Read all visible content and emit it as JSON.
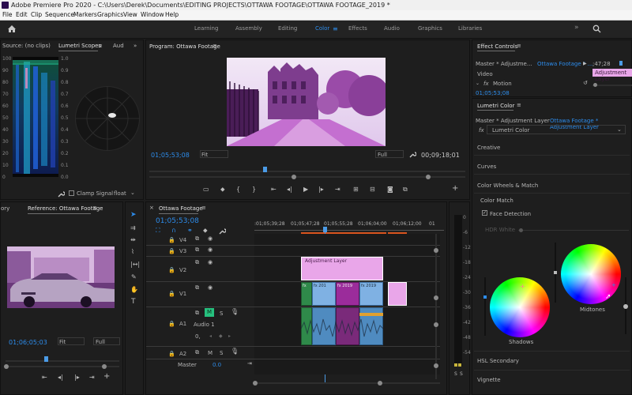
{
  "title_bar": {
    "text": "Adobe Premiere Pro 2020 - C:\\Users\\Derek\\Documents\\EDITING PROJECTS\\OTTAWA FOOTAGE\\OTTAWA FOOTAGE_2019 *"
  },
  "menu": [
    "File",
    "Edit",
    "Clip",
    "Sequence",
    "Markers",
    "Graphics",
    "View",
    "Window",
    "Help"
  ],
  "workspace_tabs": [
    "Learning",
    "Assembly",
    "Editing",
    "Color",
    "Effects",
    "Audio",
    "Graphics",
    "Libraries"
  ],
  "active_workspace": "Color",
  "colors": {
    "accent": "#2d8ceb",
    "adjustment_layer": "#e9a6e9",
    "video_clip": "#7fb1e3",
    "audio_clip": "#2f8a4a",
    "purple_clip": "#9b2c9b",
    "playhead": "#4b9be6"
  },
  "scopes_panel": {
    "tabs": [
      "Source: (no clips)",
      "Lumetri Scopes",
      "Aud"
    ],
    "scale_left": [
      "100",
      "90",
      "80",
      "70",
      "60",
      "50",
      "40",
      "30",
      "20",
      "10",
      "0"
    ],
    "scale_right": [
      "1.0",
      "0.9",
      "0.8",
      "0.7",
      "0.6",
      "0.5",
      "0.4",
      "0.3",
      "0.2",
      "0.1",
      "0.0"
    ],
    "clamp_signal": "Clamp Signal",
    "float": "float"
  },
  "program_monitor": {
    "title": "Program: Ottawa Footage",
    "current_time": "01;05;53;08",
    "fit": "Fit",
    "quality": "Full",
    "duration": "00;09;18;01"
  },
  "effect_controls": {
    "title": "Effect Controls",
    "master": "Master * Adjustme...",
    "sequence": "Ottawa Footage * ...",
    "ruler_time": ";47;28",
    "clip_label": "Adjustment Layer",
    "video_label": "Video",
    "motion": "Motion",
    "time": "01;05;53;08"
  },
  "reference_monitor": {
    "tab_left": "ory",
    "title": "Reference: Ottawa Footage",
    "time": "01;06;05;03",
    "fit": "Fit",
    "quality": "Full"
  },
  "timeline": {
    "title": "Ottawa Footage",
    "time": "01;05;53;08",
    "ruler": ":01;05;39;28",
    "ruler2": "01;05;47;28",
    "ruler3": "01;05;55;28",
    "ruler4": "01;06;04;00",
    "ruler5": "01;06;12;00",
    "ruler6": "01",
    "tracks_video": [
      "V4",
      "V3",
      "V2",
      "V1"
    ],
    "tracks_audio": [
      "A1",
      "A2"
    ],
    "audio1_name": "Audio 1",
    "master_label": "Master",
    "master_value": "0.0",
    "adjustment_clip": "Adjustment Layer",
    "v1_labels": [
      "fx",
      "fx 201",
      "fx 2019",
      "fx 2019"
    ],
    "mute": "M",
    "solo": "S",
    "audio_zero": "0,",
    "meter_scale": [
      "0",
      "-6",
      "-12",
      "-18",
      "-24",
      "-30",
      "-36",
      "-42",
      "-48",
      "-54"
    ],
    "meter_bottom": [
      "S",
      "S"
    ]
  },
  "lumetri": {
    "title": "Lumetri Color",
    "master": "Master * Adjustment Layer",
    "sequence": "Ottawa Footage * Adjustment Layer",
    "fx_name": "Lumetri Color",
    "sections": [
      "Creative",
      "Curves",
      "Color Wheels & Match"
    ],
    "color_match": "Color Match",
    "face_detection": "Face Detection",
    "hdr_white": "HDR White",
    "shadows": "Shadows",
    "midtones": "Midtones",
    "hsl": "HSL Secondary",
    "vignette": "Vignette"
  }
}
